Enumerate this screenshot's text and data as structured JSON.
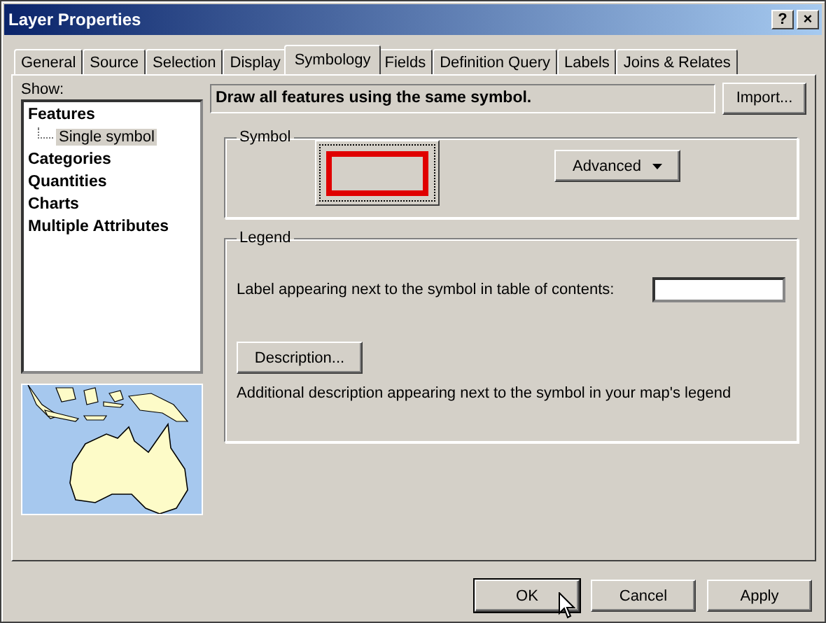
{
  "window": {
    "title": "Layer Properties",
    "help_button": "?",
    "close_button": "×"
  },
  "tabs": [
    {
      "label": "General",
      "selected": false
    },
    {
      "label": "Source",
      "selected": false
    },
    {
      "label": "Selection",
      "selected": false
    },
    {
      "label": "Display",
      "selected": false
    },
    {
      "label": "Symbology",
      "selected": true
    },
    {
      "label": "Fields",
      "selected": false
    },
    {
      "label": "Definition Query",
      "selected": false
    },
    {
      "label": "Labels",
      "selected": false
    },
    {
      "label": "Joins & Relates",
      "selected": false
    }
  ],
  "show": {
    "label": "Show:",
    "items": [
      {
        "label": "Features",
        "selected": false,
        "children": [
          {
            "label": "Single symbol",
            "selected": true
          }
        ]
      },
      {
        "label": "Categories",
        "selected": false
      },
      {
        "label": "Quantities",
        "selected": false
      },
      {
        "label": "Charts",
        "selected": false
      },
      {
        "label": "Multiple Attributes",
        "selected": false
      }
    ]
  },
  "description_bar": "Draw all features using the same symbol.",
  "import_button": "Import...",
  "symbol_group": {
    "title": "Symbol",
    "advanced_button": "Advanced"
  },
  "legend_group": {
    "title": "Legend",
    "label_text": "Label appearing next to the symbol in table of contents:",
    "description_button": "Description...",
    "description_note": "Additional description appearing next to the symbol in your map's legend"
  },
  "buttons": [
    {
      "label": "OK",
      "default": true
    },
    {
      "label": "Cancel",
      "default": false
    },
    {
      "label": "Apply",
      "default": false
    }
  ]
}
